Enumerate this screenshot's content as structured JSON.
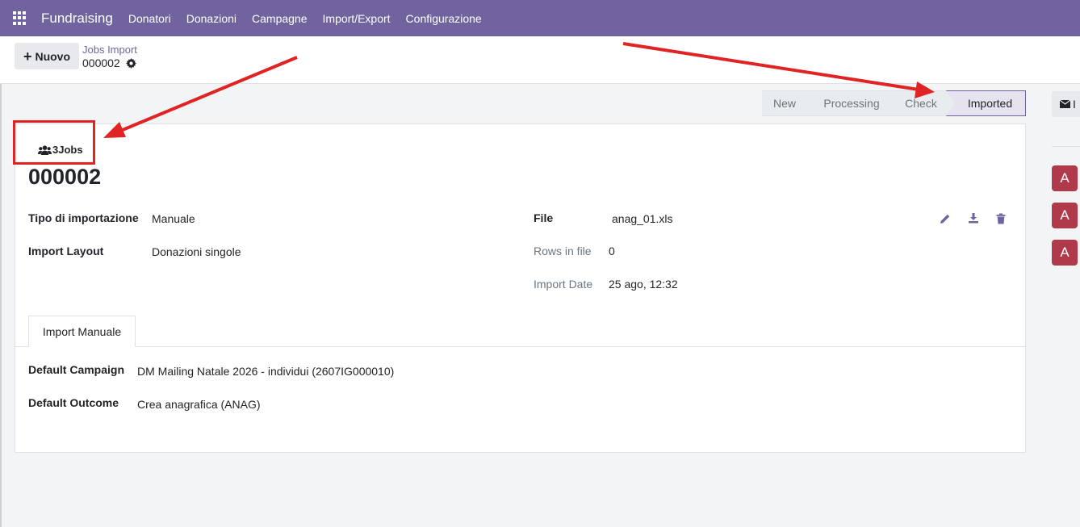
{
  "navbar": {
    "app_icon": "apps-grid-icon",
    "brand": "Fundraising",
    "menu": [
      "Donatori",
      "Donazioni",
      "Campagne",
      "Import/Export",
      "Configurazione"
    ]
  },
  "control_panel": {
    "new_button": "Nuovo",
    "breadcrumb": "Jobs Import",
    "record_name": "000002"
  },
  "statusbar": {
    "stages": [
      "New",
      "Processing",
      "Check",
      "Imported"
    ],
    "active": "Imported"
  },
  "form": {
    "jobs_button": "3Jobs",
    "title": "000002",
    "fields_left": [
      {
        "label": "Tipo di importazione",
        "value": "Manuale"
      },
      {
        "label": "Import Layout",
        "value": "Donazioni singole"
      }
    ],
    "fields_right": [
      {
        "label": "File",
        "value": "anag_01.xls"
      },
      {
        "label": "Rows in file",
        "value": "0"
      },
      {
        "label": "Import Date",
        "value": "25 ago, 12:32"
      }
    ],
    "tab_label": "Import Manuale",
    "tab_fields": [
      {
        "label": "Default Campaign",
        "value": "DM Mailing Natale 2026 -  individui (2607IG000010)"
      },
      {
        "label": "Default Outcome",
        "value": "Crea anagrafica (ANAG)"
      }
    ]
  },
  "chatter": {
    "button_text": "I",
    "avatars": [
      "A",
      "A",
      "A"
    ]
  },
  "colors": {
    "navbar": "#71639e",
    "accent": "#71639e",
    "annotation": "#e02424",
    "avatar": "#b03a4a"
  }
}
